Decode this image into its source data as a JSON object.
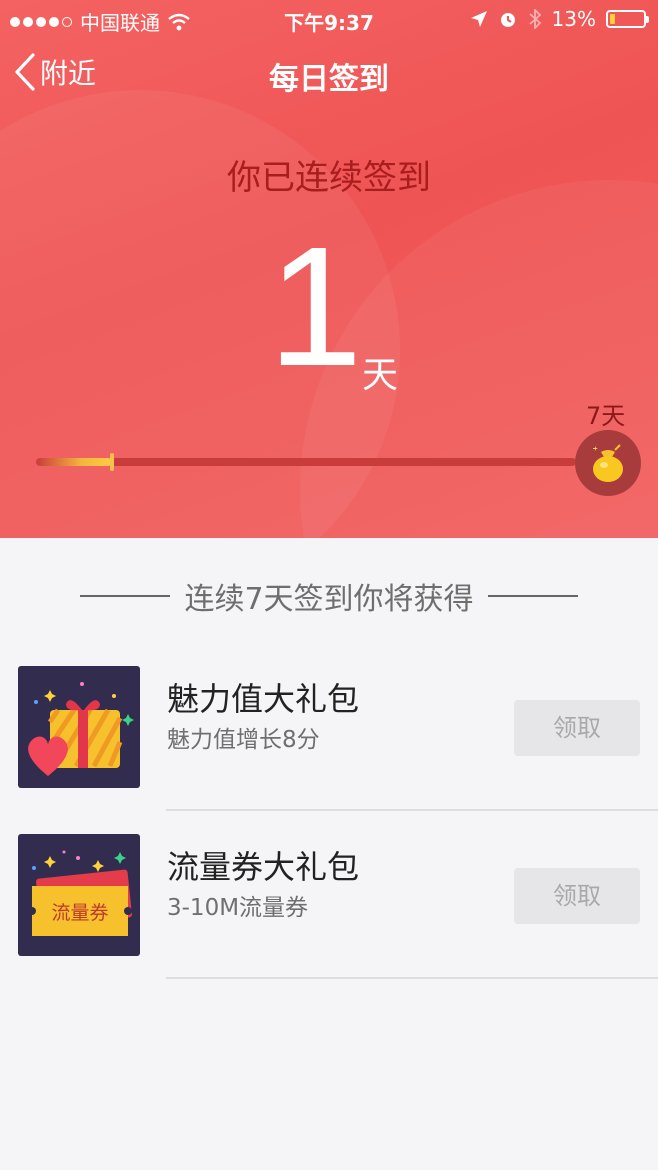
{
  "status_bar": {
    "carrier": "中国联通",
    "time": "下午9:37",
    "battery_text": "13%"
  },
  "nav": {
    "back_label": "附近",
    "title": "每日签到"
  },
  "streak": {
    "label": "你已连续签到",
    "days": "1",
    "unit": "天",
    "goal_label": "7天",
    "progress_fraction": 0.14
  },
  "rewards_section": {
    "heading": "连续7天签到你将获得"
  },
  "rewards": [
    {
      "name": "魅力值大礼包",
      "desc": "魅力值增长8分",
      "button": "领取",
      "icon": "gift-box-heart-icon"
    },
    {
      "name": "流量券大礼包",
      "desc": "3-10M流量券",
      "button": "领取",
      "icon": "data-coupon-icon",
      "coupon_text": "流量券"
    }
  ],
  "colors": {
    "header_red": "#f05858",
    "gold": "#f8c14a",
    "icon_bg": "#322c4f"
  }
}
